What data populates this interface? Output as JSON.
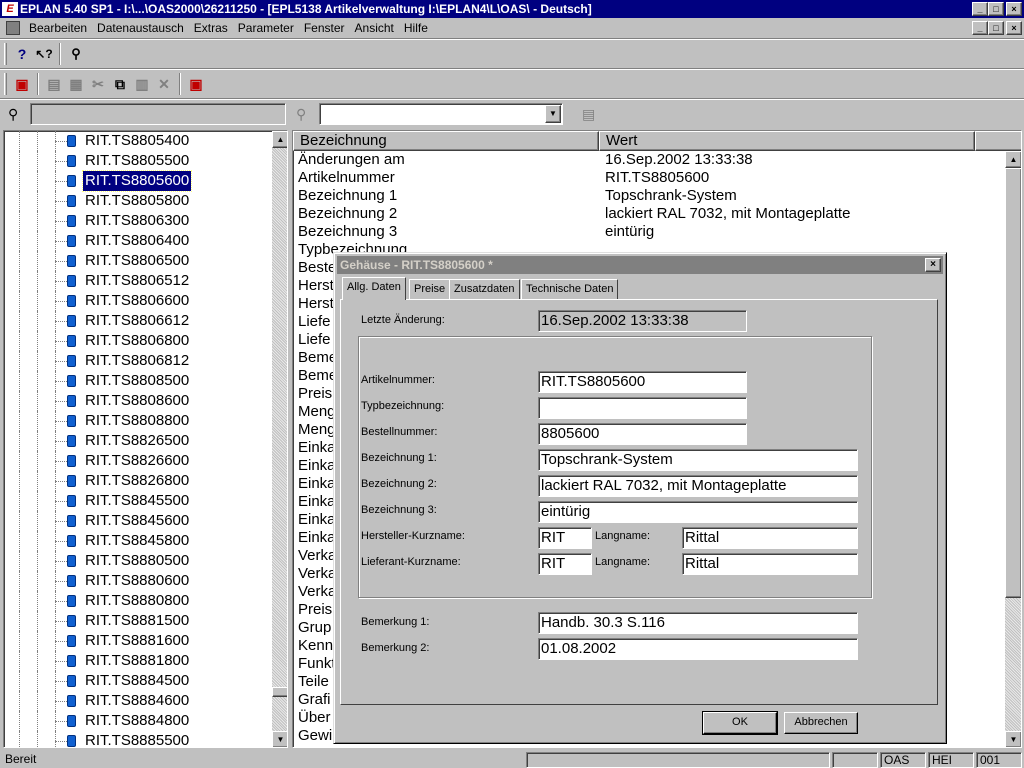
{
  "window": {
    "title": "EPLAN 5.40 SP1 - I:\\...\\OAS2000\\26211250 - [EPL5138 Artikelverwaltung I:\\EPLAN4\\L\\OAS\\ - Deutsch]",
    "min": "_",
    "max": "□",
    "close": "×"
  },
  "menu": {
    "items": [
      "Bearbeiten",
      "Datenaustausch",
      "Extras",
      "Parameter",
      "Fenster",
      "Ansicht",
      "Hilfe"
    ]
  },
  "tree": {
    "selected_index": 2,
    "items": [
      "RIT.TS8805400",
      "RIT.TS8805500",
      "RIT.TS8805600",
      "RIT.TS8805800",
      "RIT.TS8806300",
      "RIT.TS8806400",
      "RIT.TS8806500",
      "RIT.TS8806512",
      "RIT.TS8806600",
      "RIT.TS8806612",
      "RIT.TS8806800",
      "RIT.TS8806812",
      "RIT.TS8808500",
      "RIT.TS8808600",
      "RIT.TS8808800",
      "RIT.TS8826500",
      "RIT.TS8826600",
      "RIT.TS8826800",
      "RIT.TS8845500",
      "RIT.TS8845600",
      "RIT.TS8845800",
      "RIT.TS8880500",
      "RIT.TS8880600",
      "RIT.TS8880800",
      "RIT.TS8881500",
      "RIT.TS8881600",
      "RIT.TS8881800",
      "RIT.TS8884500",
      "RIT.TS8884600",
      "RIT.TS8884800",
      "RIT.TS8885500"
    ]
  },
  "list": {
    "col1": "Bezeichnung",
    "col2": "Wert",
    "rows": [
      {
        "name": "Änderungen am",
        "value": "16.Sep.2002 13:33:38"
      },
      {
        "name": "Artikelnummer",
        "value": "RIT.TS8805600"
      },
      {
        "name": "Bezeichnung 1",
        "value": "Topschrank-System"
      },
      {
        "name": "Bezeichnung 2",
        "value": "lackiert RAL 7032, mit Montageplatte"
      },
      {
        "name": "Bezeichnung 3",
        "value": "eintürig"
      },
      {
        "name": "Typbezeichnung",
        "value": ""
      },
      {
        "name": "Beste",
        "value": ""
      },
      {
        "name": "Herst",
        "value": ""
      },
      {
        "name": "Herst",
        "value": ""
      },
      {
        "name": "Liefe",
        "value": ""
      },
      {
        "name": "Liefe",
        "value": ""
      },
      {
        "name": "Bemе",
        "value": ""
      },
      {
        "name": "Bemе",
        "value": ""
      },
      {
        "name": "Preis",
        "value": ""
      },
      {
        "name": "Meng",
        "value": ""
      },
      {
        "name": "Meng",
        "value": ""
      },
      {
        "name": "Einka",
        "value": ""
      },
      {
        "name": "Einka",
        "value": ""
      },
      {
        "name": "Einka",
        "value": ""
      },
      {
        "name": "Einka",
        "value": ""
      },
      {
        "name": "Einka",
        "value": ""
      },
      {
        "name": "Einka",
        "value": ""
      },
      {
        "name": "Verka",
        "value": ""
      },
      {
        "name": "Verka",
        "value": ""
      },
      {
        "name": "Verka",
        "value": ""
      },
      {
        "name": "Preis",
        "value": ""
      },
      {
        "name": "Grup",
        "value": ""
      },
      {
        "name": "Kenn",
        "value": ""
      },
      {
        "name": "Funkt",
        "value": ""
      },
      {
        "name": "Teile",
        "value": ""
      },
      {
        "name": "Grafi",
        "value": ""
      },
      {
        "name": "Über",
        "value": ""
      },
      {
        "name": "Gewi",
        "value": ""
      }
    ]
  },
  "status": {
    "ready": "Bereit",
    "oas": "OAS",
    "hei": "HEI",
    "num": "001"
  },
  "dialog": {
    "title": "Gehäuse - RIT.TS8805600 *",
    "tabs": [
      "Allg. Daten",
      "Preise",
      "Zusatzdaten",
      "Technische Daten"
    ],
    "labels": {
      "last_change": "Letzte Änderung:",
      "article": "Artikelnummer:",
      "type": "Typbezeichnung:",
      "order": "Bestellnummer:",
      "desc1": "Bezeichnung 1:",
      "desc2": "Bezeichnung 2:",
      "desc3": "Bezeichnung 3:",
      "manufacturer": "Hersteller-Kurzname:",
      "supplier": "Lieferant-Kurzname:",
      "longname1": "Langname:",
      "longname2": "Langname:",
      "remark1": "Bemerkung 1:",
      "remark2": "Bemerkung 2:"
    },
    "values": {
      "last_change": "16.Sep.2002 13:33:38",
      "article": "RIT.TS8805600",
      "type": "",
      "order": "8805600",
      "desc1": "Topschrank-System",
      "desc2": "lackiert RAL 7032, mit Montageplatte",
      "desc3": "eintürig",
      "manufacturer": "RIT",
      "manufacturer_long": "Rittal",
      "supplier": "RIT",
      "supplier_long": "Rittal",
      "remark1": "Handb. 30.3 S.116",
      "remark2": "01.08.2002"
    },
    "ok": "OK",
    "cancel": "Abbrechen"
  },
  "icons": {
    "help": "question-icon",
    "context_help": "context-help-icon",
    "binoculars": "binoculars-icon"
  }
}
